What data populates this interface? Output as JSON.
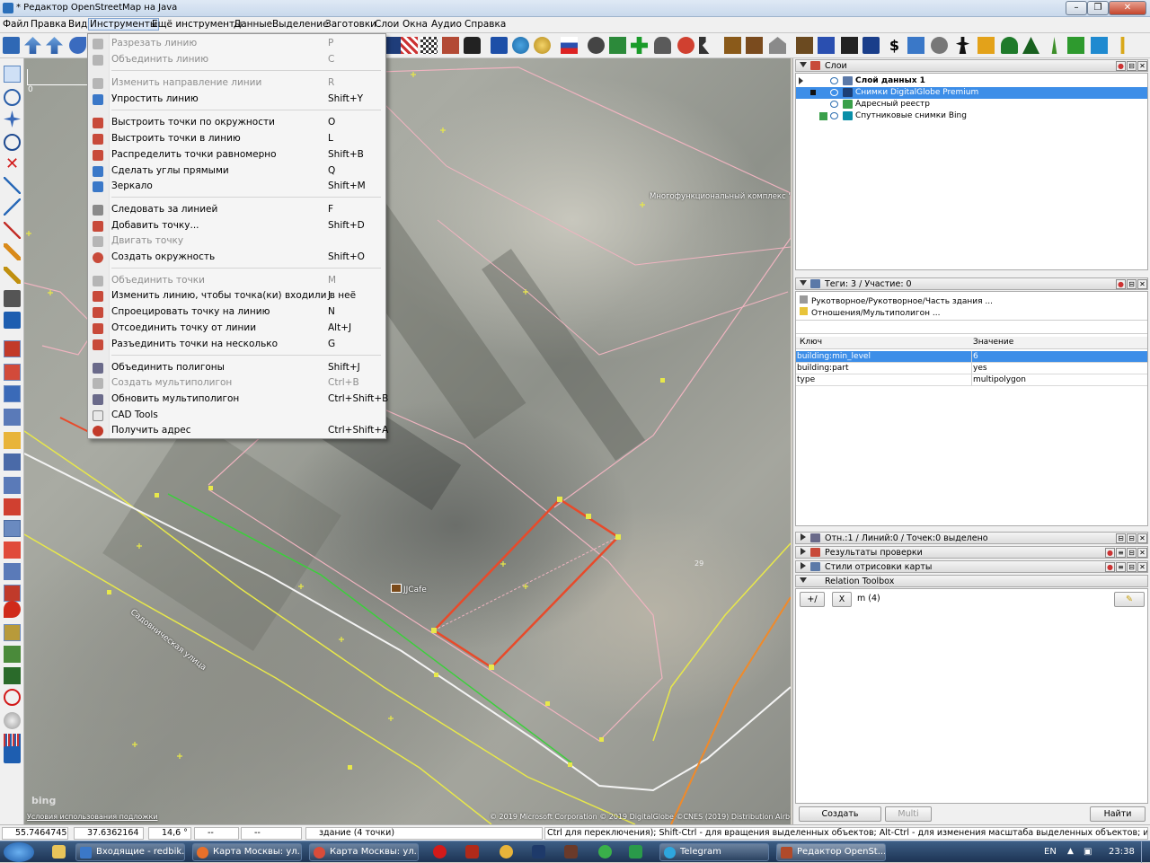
{
  "window": {
    "title": "* Редактор OpenStreetMap на Java",
    "min": "–",
    "max": "❐",
    "close": "✕"
  },
  "menubar": [
    "Файл",
    "Правка",
    "Вид",
    "Инструменты",
    "Ещё инструменты",
    "Данные",
    "Выделение",
    "Заготовки",
    "Слои",
    "Окна",
    "Аудио",
    "Справка"
  ],
  "tools_menu": [
    {
      "label": "Разрезать линию",
      "shortcut": "P",
      "disabled": true
    },
    {
      "label": "Объединить линию",
      "shortcut": "C",
      "disabled": true
    },
    {
      "label": "Изменить направление линии",
      "shortcut": "R",
      "disabled": true
    },
    {
      "label": "Упростить линию",
      "shortcut": "Shift+Y",
      "disabled": false
    },
    {
      "label": "Выстроить точки по окружности",
      "shortcut": "O",
      "disabled": false
    },
    {
      "label": "Выстроить точки в линию",
      "shortcut": "L",
      "disabled": false
    },
    {
      "label": "Распределить точки равномерно",
      "shortcut": "Shift+B",
      "disabled": false
    },
    {
      "label": "Сделать углы прямыми",
      "shortcut": "Q",
      "disabled": false
    },
    {
      "label": "Зеркало",
      "shortcut": "Shift+M",
      "disabled": false
    },
    {
      "label": "Следовать за линией",
      "shortcut": "F",
      "disabled": false
    },
    {
      "label": "Добавить точку...",
      "shortcut": "Shift+D",
      "disabled": false
    },
    {
      "label": "Двигать точку",
      "shortcut": "",
      "disabled": true
    },
    {
      "label": "Создать окружность",
      "shortcut": "Shift+O",
      "disabled": false
    },
    {
      "label": "Объединить точки",
      "shortcut": "M",
      "disabled": true
    },
    {
      "label": "Изменить линию, чтобы точка(ки) входили в неё",
      "shortcut": "J",
      "disabled": false
    },
    {
      "label": "Спроецировать точку на линию",
      "shortcut": "N",
      "disabled": false
    },
    {
      "label": "Отсоединить точку от линии",
      "shortcut": "Alt+J",
      "disabled": false
    },
    {
      "label": "Разъединить точки на несколько",
      "shortcut": "G",
      "disabled": false
    },
    {
      "label": "Объединить полигоны",
      "shortcut": "Shift+J",
      "disabled": false
    },
    {
      "label": "Создать мультиполигон",
      "shortcut": "Ctrl+B",
      "disabled": true
    },
    {
      "label": "Обновить мультиполигон",
      "shortcut": "Ctrl+Shift+B",
      "disabled": false
    },
    {
      "label": "CAD Tools",
      "shortcut": "",
      "disabled": false
    },
    {
      "label": "Получить адрес",
      "shortcut": "Ctrl+Shift+A",
      "disabled": false
    }
  ],
  "map": {
    "scale_label": "0",
    "poi_label": "JJCafe",
    "building_label": "Многофункциональный комплекс \"Balc",
    "street_label": "Садовническая улица",
    "number_label": "29",
    "bing": "bing",
    "terms": "Условия использования подложки",
    "copyright": "© 2019 Microsoft Corporation © 2019 DigitalGlobe ©CNES (2019) Distribution Airbus DS"
  },
  "layers": {
    "title": "Слои",
    "items": [
      {
        "name": "Слой данных 1",
        "selected": false,
        "bold": true,
        "color": "#5b79a8"
      },
      {
        "name": "Снимки DigitalGlobe Premium",
        "selected": true,
        "bold": false,
        "color": "#1c3f75"
      },
      {
        "name": "Адресный реестр",
        "selected": false,
        "bold": false,
        "color": "#3aa04a"
      },
      {
        "name": "Спутниковые снимки Bing",
        "selected": false,
        "bold": false,
        "color": "#0a8fa8"
      }
    ]
  },
  "tags": {
    "title": "Теги: 3 / Участие: 0",
    "preset": "Рукотворное/Рукотворное/Часть здания ...",
    "relation": "Отношения/Мультиполигон ...",
    "col_key": "Ключ",
    "col_value": "Значение",
    "rows": [
      {
        "k": "building:min_level",
        "v": "6",
        "selected": true
      },
      {
        "k": "building:part",
        "v": "yes",
        "selected": false
      },
      {
        "k": "type",
        "v": "multipolygon",
        "selected": false
      }
    ]
  },
  "panels": [
    "Отн.:1 / Линий:0 / Точек:0 выделено",
    "Результаты проверки",
    "Стили отрисовки карты",
    "Relation Toolbox"
  ],
  "relation_toolbox": {
    "x_btn": "X",
    "m_label": "m (4)",
    "create": "Создать",
    "multi": "Multi",
    "find": "Найти"
  },
  "status": {
    "lat": "55.7464745",
    "lon": "37.6362164",
    "angle": "14,6 °",
    "heading": "--",
    "distance": "--",
    "info": "здание (4 точки)",
    "hint": "Ctrl для переключения); Shift-Ctrl - для вращения выделенных объектов; Alt-Ctrl - для изменения масштаба выделенных объектов; или для изменения выделения"
  },
  "taskbar": {
    "tasks": [
      {
        "label": "Входящие - redbik...",
        "color": "#3b78c8"
      },
      {
        "label": "Карта Москвы: ул...",
        "color": "#e8702a"
      },
      {
        "label": "Карта Москвы: ул...",
        "color": "#d94c3a"
      },
      {
        "label": "Telegram",
        "color": "#2ea6dd"
      },
      {
        "label": "Редактор OpenSt...",
        "color": "#b04a2a"
      }
    ],
    "lang": "EN",
    "time": "23:38"
  }
}
